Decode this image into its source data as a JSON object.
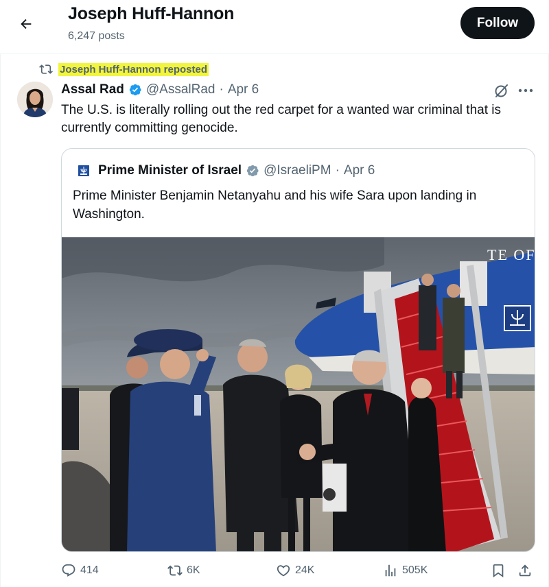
{
  "header": {
    "name": "Joseph Huff-Hannon",
    "posts_count": "6,247 posts",
    "follow_label": "Follow"
  },
  "repost": {
    "label": "Joseph Huff-Hannon reposted"
  },
  "tweet": {
    "author_name": "Assal Rad",
    "handle": "@AssalRad",
    "separator": "·",
    "date": "Apr 6",
    "text": "The U.S. is literally rolling out the red carpet for a wanted war criminal that is currently committing genocide."
  },
  "quote": {
    "author_name": "Prime Minister of Israel",
    "handle": "@IsraeliPM",
    "separator": "·",
    "date": "Apr 6",
    "text": "Prime Minister Benjamin Netanyahu and his wife Sara upon landing in Washington.",
    "plane_lettering": "TE OF"
  },
  "actions": {
    "replies": "414",
    "reposts": "6K",
    "likes": "24K",
    "views": "505K"
  },
  "icons": {
    "back": "arrow-left-icon",
    "repost": "repost-icon",
    "verified": "verified-badge-icon",
    "grok": "grok-icon",
    "more": "more-horizontal-icon",
    "reply": "reply-icon",
    "like": "heart-icon",
    "views": "views-icon",
    "bookmark": "bookmark-icon",
    "share": "share-icon"
  },
  "colors": {
    "text_primary": "#0f1419",
    "text_secondary": "#536471",
    "verified_blue": "#1d9bf0",
    "highlight": "#f2f53d",
    "follow_bg": "#0f1419"
  }
}
